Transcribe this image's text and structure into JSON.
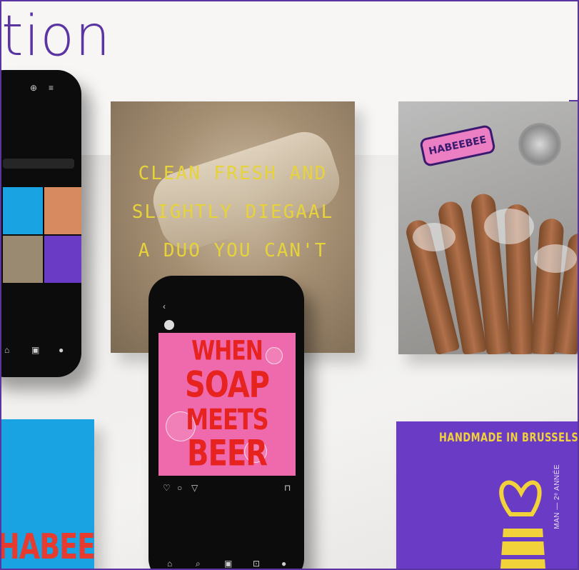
{
  "header": {
    "title": "tion"
  },
  "tiles": {
    "soap": {
      "lines": [
        "CLEAN FRESH AND",
        "SLIGHTLY DIEGAAL",
        "A DUO YOU CAN'T"
      ]
    },
    "hands": {
      "sticker": "HABEEBEE"
    },
    "blue": {
      "brand": "HABEEBEE"
    },
    "purple": {
      "headline": "HANDMADE IN BRUSSELS",
      "vertical_label": "MAN — 2ᵉ ANNÉE"
    }
  },
  "phone_center": {
    "post_lines": [
      "WHEN",
      "SOAP",
      "MEETS",
      "BEER"
    ]
  },
  "colors": {
    "accent_purple": "#5a34a0",
    "pink": "#ef6aac",
    "red": "#e6231f",
    "yellow": "#f1d23a",
    "blue": "#1aa3e3"
  }
}
